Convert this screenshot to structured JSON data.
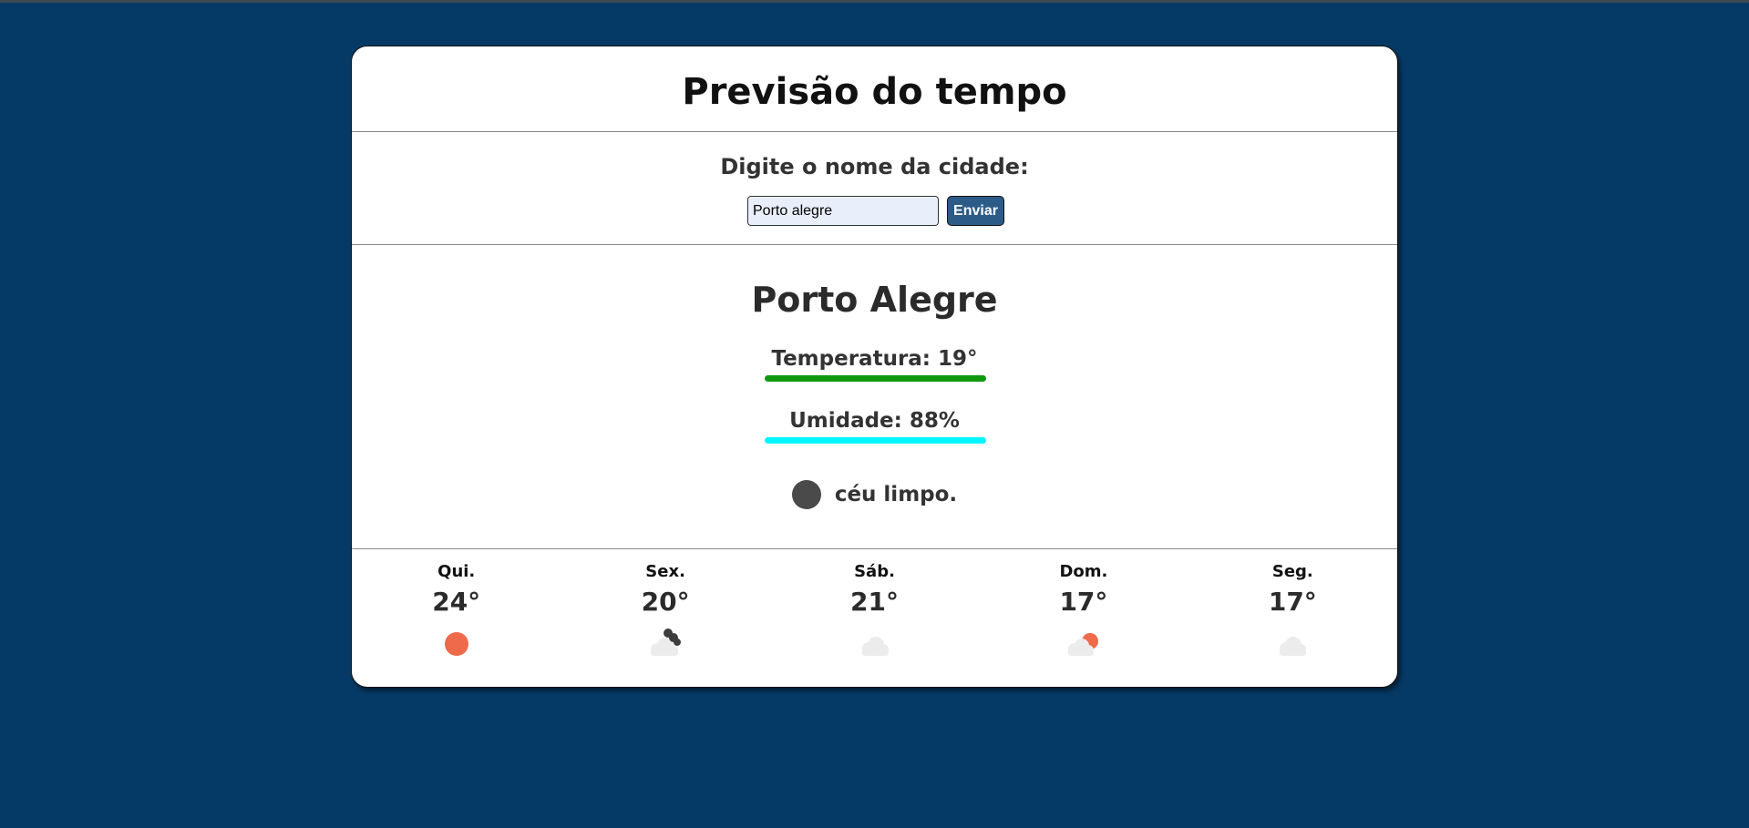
{
  "header": {
    "title": "Previsão do tempo"
  },
  "search": {
    "label": "Digite o nome da cidade:",
    "input_value": "Porto alegre",
    "button_label": "Enviar"
  },
  "current": {
    "city": "Porto Alegre",
    "temperature": "Temperatura: 19°",
    "humidity": "Umidade: 88%",
    "description": "céu limpo.",
    "icon": "moon-icon",
    "colors": {
      "temperature_bar": "#10990f",
      "humidity_bar": "#00f5ff"
    }
  },
  "forecast": [
    {
      "day": "Qui.",
      "temp": "24°",
      "icon": "sun-icon"
    },
    {
      "day": "Sex.",
      "temp": "20°",
      "icon": "cloud-moon-icon"
    },
    {
      "day": "Sáb.",
      "temp": "21°",
      "icon": "cloud-icon"
    },
    {
      "day": "Dom.",
      "temp": "17°",
      "icon": "cloud-sun-icon"
    },
    {
      "day": "Seg.",
      "temp": "17°",
      "icon": "cloud-icon"
    }
  ],
  "colors": {
    "background": "#063a66",
    "accent_button": "#2d5b87",
    "sun": "#ee6a4a"
  }
}
